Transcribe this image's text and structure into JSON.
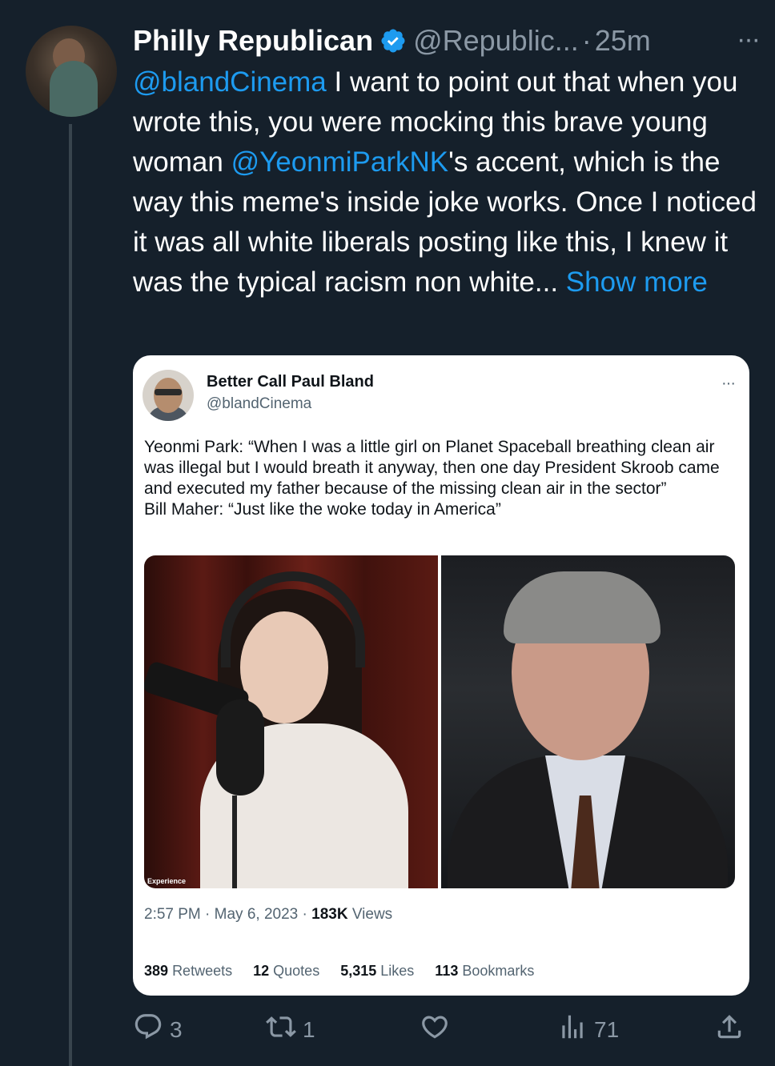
{
  "tweet": {
    "display_name": "Philly Republican",
    "handle": "@Republic...",
    "separator": "·",
    "time": "25m",
    "more": "···",
    "body": {
      "mention1": "@blandCinema",
      "text1": " I want to point out that when you wrote this, you were mocking this brave young woman ",
      "mention2": "@YeonmiParkNK",
      "text2": "'s accent, which is the way this meme's inside joke works. Once I noticed it was all white liberals posting like this, I knew it was the typical racism non white...",
      "show_more": "Show more"
    }
  },
  "quoted": {
    "name": "Better Call Paul Bland",
    "handle": "@blandCinema",
    "more": "···",
    "line1": "Yeonmi Park: “When I was a little girl on Planet Spaceball breathing clean air was illegal but I would breath it anyway, then one day President Skroob came and executed my father because of the missing clean air in the sector”",
    "line2": "Bill Maher: “Just like the woke today in America”",
    "watermark": "Experience",
    "time": "2:57 PM",
    "sep": "·",
    "date": "May 6, 2023",
    "views_count": "183K",
    "views_label": "Views",
    "stats": [
      {
        "count": "389",
        "label": "Retweets"
      },
      {
        "count": "12",
        "label": "Quotes"
      },
      {
        "count": "5,315",
        "label": "Likes"
      },
      {
        "count": "113",
        "label": "Bookmarks"
      }
    ]
  },
  "actions": {
    "reply_count": "3",
    "retweet_count": "1",
    "views_count": "71"
  },
  "colors": {
    "background": "#15202b",
    "accent": "#1d9bf0",
    "muted": "#8b98a5"
  }
}
